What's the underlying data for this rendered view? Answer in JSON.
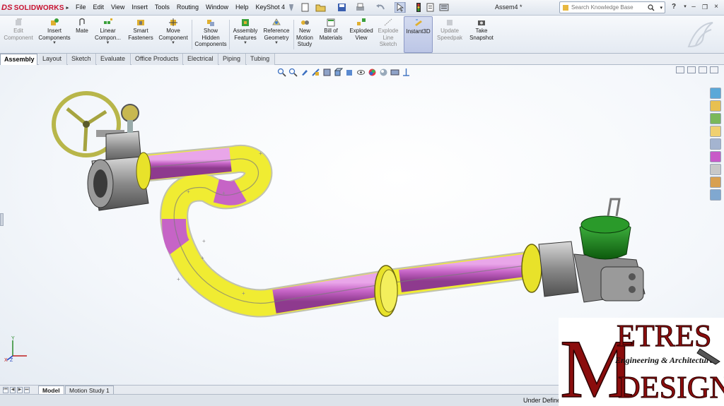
{
  "app": {
    "brand_ds": "DS",
    "brand_name": "SOLIDWORKS",
    "document_title": "Assem4 *",
    "menus": [
      "File",
      "Edit",
      "View",
      "Insert",
      "Tools",
      "Routing",
      "Window",
      "Help",
      "KeyShot 4"
    ],
    "search_placeholder": "Search Knowledge Base",
    "help_label": "?"
  },
  "command_manager": {
    "edit_component": "Edit\nComponent",
    "insert_components": "Insert\nComponents",
    "mate": "Mate",
    "linear_component": "Linear\nCompon...",
    "smart_fasteners": "Smart\nFasteners",
    "move_component": "Move\nComponent",
    "show_hidden": "Show\nHidden\nComponents",
    "assembly_features": "Assembly\nFeatures",
    "reference_geometry": "Reference\nGeometry",
    "new_motion_study": "New\nMotion\nStudy",
    "bill_of_materials": "Bill of\nMaterials",
    "exploded_view": "Exploded\nView",
    "explode_line_sketch": "Explode\nLine\nSketch",
    "instant3d": "Instant3D",
    "update_speedpak": "Update\nSpeedpak",
    "take_snapshot": "Take\nSnapshot"
  },
  "tabs": [
    "Assembly",
    "Layout",
    "Sketch",
    "Evaluate",
    "Office Products",
    "Electrical",
    "Piping",
    "Tubing"
  ],
  "bottom_tabs": [
    "Model",
    "Motion Study 1"
  ],
  "status": "Under Defined",
  "watermark": {
    "big_m": "M",
    "etres": "ETRES",
    "engineering": "Engineering & Architecture",
    "design": "DESIGN"
  },
  "colors": {
    "pipe_magenta": "#cc66cc",
    "elbow_yellow": "#f0ec32",
    "valve_green": "#1e8a1e",
    "flange_yellow": "#e8e22a",
    "wheel_olive": "#b8b64a",
    "watermark_red": "#8b0d0d"
  },
  "icons": {
    "axis_triad": "xyz-triad-icon"
  }
}
